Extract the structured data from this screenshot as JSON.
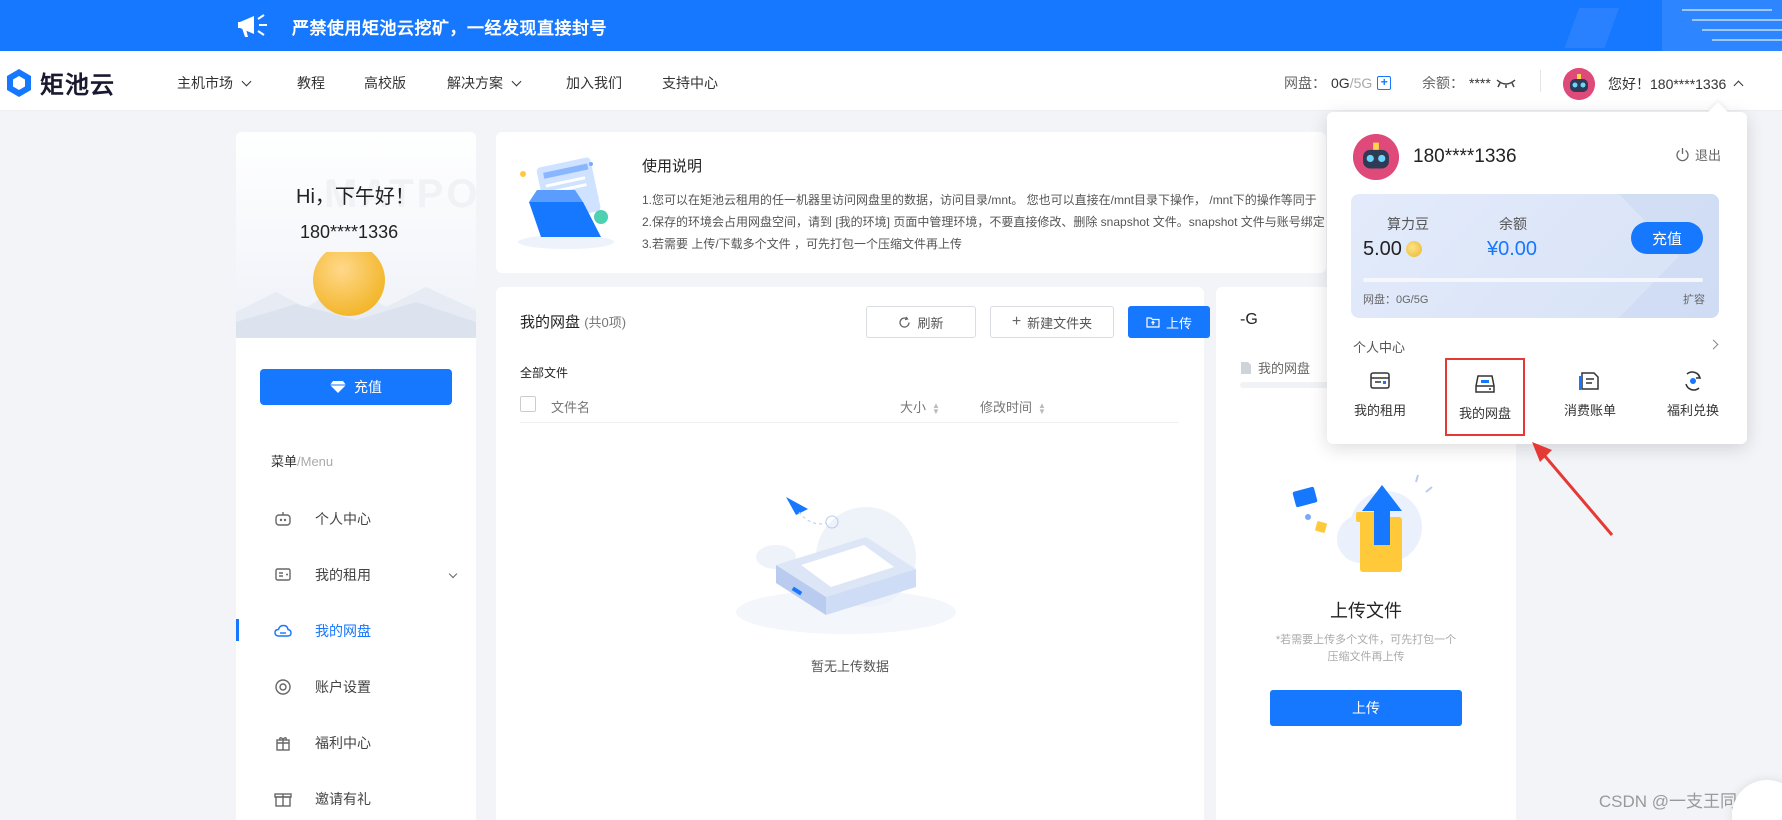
{
  "banner": {
    "text": "严禁使用矩池云挖矿，一经发现直接封号"
  },
  "nav": {
    "brand": "矩池云",
    "items": [
      {
        "label": "主机市场",
        "dropdown": true
      },
      {
        "label": "教程",
        "dropdown": false
      },
      {
        "label": "高校版",
        "dropdown": false
      },
      {
        "label": "解决方案",
        "dropdown": true
      },
      {
        "label": "加入我们",
        "dropdown": false
      },
      {
        "label": "支持中心",
        "dropdown": false
      }
    ],
    "disk_label": "网盘：",
    "disk_used": "0G",
    "disk_total": "/5G",
    "balance_label": "余额：",
    "balance_value": "****",
    "greeting": "您好！180****1336"
  },
  "sidebar": {
    "hi": "Hi，下午好！",
    "ghost": "MATPO",
    "user": "180****1336",
    "charge": "充值",
    "menu_title": "菜单",
    "menu_title_en": "/Menu",
    "items": [
      {
        "label": "个人中心",
        "icon": "robot-icon",
        "active": false
      },
      {
        "label": "我的租用",
        "icon": "server-icon",
        "active": false,
        "expand": true
      },
      {
        "label": "我的网盘",
        "icon": "cloud-icon",
        "active": true
      },
      {
        "label": "账户设置",
        "icon": "settings-icon",
        "active": false
      },
      {
        "label": "福利中心",
        "icon": "gift-icon",
        "active": false
      },
      {
        "label": "邀请有礼",
        "icon": "present-icon",
        "active": false
      }
    ]
  },
  "usage": {
    "title": "使用说明",
    "line1": "1.您可以在矩池云租用的任一机器里访问网盘里的数据，访问目录/mnt。 您也可以直接在/mnt目录下操作， /mnt下的操作等同于",
    "line2": "2.保存的环境会占用网盘空间，请到 [我的环境] 页面中管理环境，不要直接修改、删除 snapshot 文件。snapshot 文件与账号绑定，",
    "line3": "3.若需要 上传/下载多个文件 ，可先打包一个压缩文件再上传"
  },
  "disk": {
    "title": "我的网盘",
    "count": "(共0项)",
    "refresh": "刷新",
    "new_folder": "新建文件夹",
    "upload": "上传",
    "all_files": "全部文件",
    "col_name": "文件名",
    "col_size": "大小",
    "col_modified": "修改时间",
    "empty": "暂无上传数据"
  },
  "right_card": {
    "title": "-G",
    "sub": "我的网盘",
    "upload_title": "上传文件",
    "upload_tip": "*若需要上传多个文件，可先打包一个压缩文件再上传",
    "upload_button": "上传"
  },
  "dropdown": {
    "user": "180****1336",
    "logout": "退出",
    "points_label": "算力豆",
    "points_value": "5.00",
    "balance_label": "余额",
    "balance_value": "¥0.00",
    "recharge": "充值",
    "disk_info": "网盘：0G/5G",
    "expand": "扩容",
    "center": "个人中心",
    "quick": [
      {
        "label": "我的租用",
        "icon": "rental-icon",
        "highlighted": false
      },
      {
        "label": "我的网盘",
        "icon": "disk-icon",
        "highlighted": true
      },
      {
        "label": "消费账单",
        "icon": "bill-icon",
        "highlighted": false
      },
      {
        "label": "福利兑换",
        "icon": "exchange-icon",
        "highlighted": false
      }
    ]
  },
  "watermark": "CSDN @一支王同学",
  "colors": {
    "primary": "#1677ff",
    "highlight": "#e53935"
  }
}
